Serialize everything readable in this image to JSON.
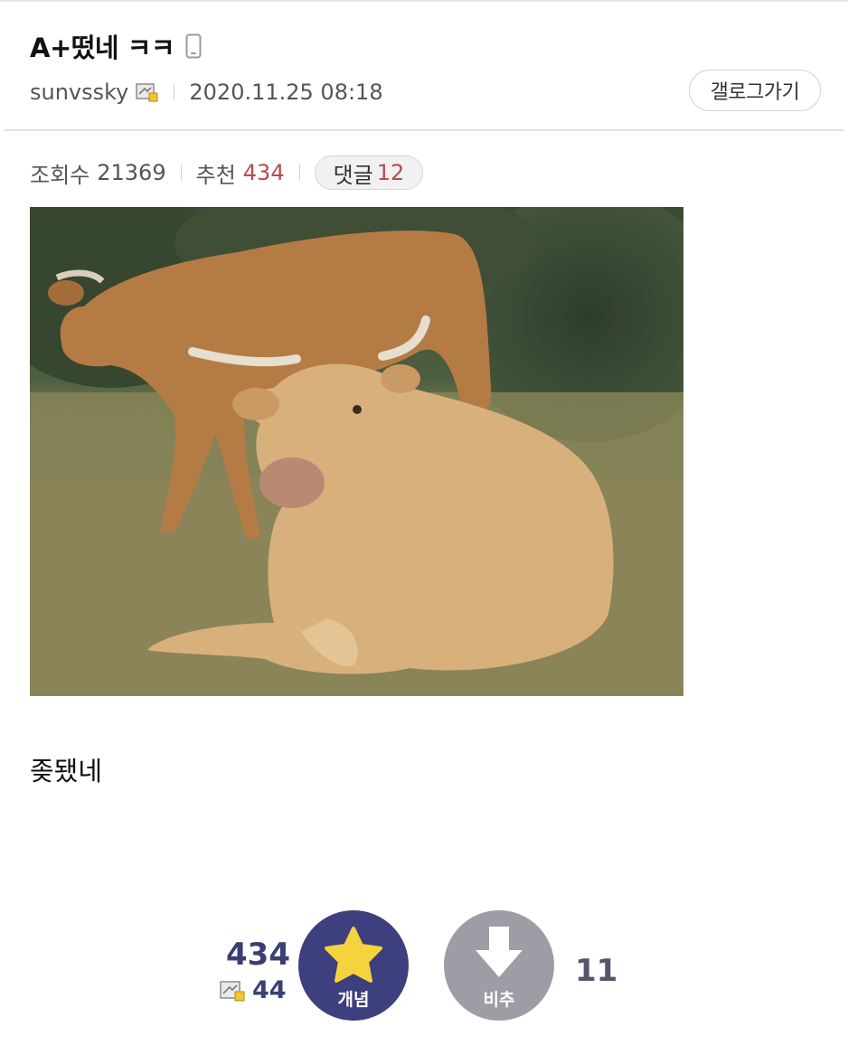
{
  "post": {
    "title": "A+떴네 ㅋㅋ",
    "author": "sunvssky",
    "date": "2020.11.25 08:18",
    "gallog_button": "갤로그가기",
    "views_label": "조회수",
    "views": "21369",
    "recommend_label": "추천",
    "recommend": "434",
    "comments_label": "댓글",
    "comments": "12",
    "body": "좆됐네"
  },
  "votes": {
    "up_count": "434",
    "fixed_count": "44",
    "up_label": "개념",
    "down_label": "비추",
    "down_count": "11"
  },
  "icons": [
    "mobile-icon",
    "gallog-icon",
    "star-icon",
    "down-arrow-icon"
  ],
  "colors": {
    "accent_red": "#b84a4a",
    "upvote_navy": "#3d3f7e",
    "downvote_gray": "#9c9da5",
    "star_yellow": "#f5d33c"
  }
}
